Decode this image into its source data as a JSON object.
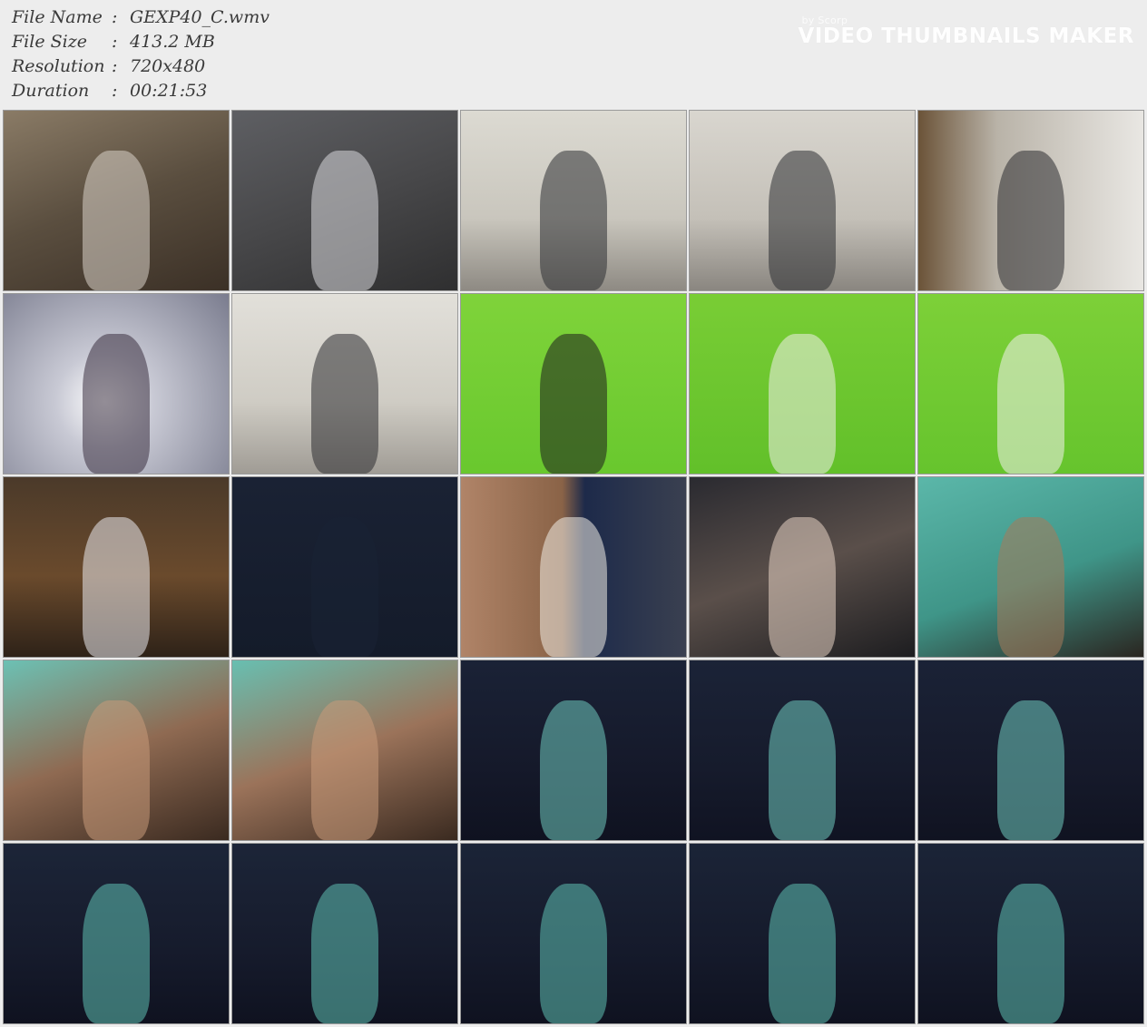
{
  "file_info": [
    {
      "label": "File Name",
      "sep": ":",
      "value": "GEXP40_C.wmv"
    },
    {
      "label": "File Size",
      "sep": ":",
      "value": "413.2 MB"
    },
    {
      "label": "Resolution",
      "sep": ":",
      "value": "720x480"
    },
    {
      "label": "Duration",
      "sep": ":",
      "value": "00:21:53"
    }
  ],
  "watermark": {
    "by_text": "by Scorp",
    "title": "VIDEO THUMBNAILS MAKER"
  },
  "thumbnails": [
    {
      "bg": "linear-gradient(160deg,#8a7b66 0%,#5a4e3f 50%,#3b3026 100%)",
      "accent": "#d8d2c8"
    },
    {
      "bg": "linear-gradient(160deg,#5e5f63 0%,#48484a 50%,#2f2f30 100%)",
      "accent": "#d9d9dc"
    },
    {
      "bg": "linear-gradient(180deg,#dcdad2 0%,#c9c6bd 60%,#8e8a83 100%)",
      "accent": "#2e2f33"
    },
    {
      "bg": "linear-gradient(180deg,#d9d6cf 0%,#c4c0b8 60%,#8a8680 100%)",
      "accent": "#2e2f33"
    },
    {
      "bg": "linear-gradient(90deg,#6b5338 0%,#b9b3a8 35%,#e9e7e3 100%)",
      "accent": "#2c2c30"
    },
    {
      "bg": "radial-gradient(circle at 45% 60%,#ffffff 0%,#c8c9d4 30%,#7a7c8e 100%)",
      "accent": "#3a3040"
    },
    {
      "bg": "linear-gradient(180deg,#e2e0da 0%,#cfccc4 60%,#a09c95 100%)",
      "accent": "#2d2e32"
    },
    {
      "bg": "linear-gradient(180deg,#7fd33a 0%,#69c82e 100%)",
      "accent": "#1e1e1e"
    },
    {
      "bg": "linear-gradient(180deg,#79cd35 0%,#62c02a 100%)",
      "accent": "#f1efe9"
    },
    {
      "bg": "linear-gradient(180deg,#7dd038 0%,#66c42d 100%)",
      "accent": "#f3f1ec"
    },
    {
      "bg": "linear-gradient(180deg,#4b3a2a 0%,#6a4a2c 55%,#2e2218 100%)",
      "accent": "#e9e9ef"
    },
    {
      "bg": "linear-gradient(180deg,#1a2234 0%,#141b2a 100%)",
      "accent": "#1a2234"
    },
    {
      "bg": "linear-gradient(90deg,#b08468 0%,#8a6347 45%,#1d2a4a 55%,#3a4050 100%)",
      "accent": "#f0ede6"
    },
    {
      "bg": "linear-gradient(160deg,#2a2a30 0%,#5a4f4a 50%,#1d1d20 100%)",
      "accent": "#e8d4c4"
    },
    {
      "bg": "linear-gradient(160deg,#5bb7a9 0%,#3f9588 55%,#2a2520 100%)",
      "accent": "#a87a5a"
    },
    {
      "bg": "linear-gradient(160deg,#6cc1b4 0%,#8f6a52 50%,#3a2a20 100%)",
      "accent": "#c99a7a"
    },
    {
      "bg": "linear-gradient(160deg,#68bfb1 0%,#9b735a 50%,#3a2a20 100%)",
      "accent": "#c99a7a"
    },
    {
      "bg": "linear-gradient(180deg,#1a2236 0%,#15192a 60%,#0f1220 100%)",
      "accent": "#6fc8bd"
    },
    {
      "bg": "linear-gradient(180deg,#1b2337 0%,#161b2c 60%,#101322 100%)",
      "accent": "#6fc8bd"
    },
    {
      "bg": "linear-gradient(180deg,#1a2236 0%,#161a2b 60%,#101321 100%)",
      "accent": "#6fc8bd"
    },
    {
      "bg": "linear-gradient(180deg,#1c2538 0%,#161b2c 60%,#0f1220 100%)",
      "accent": "#5fbfb2"
    },
    {
      "bg": "linear-gradient(180deg,#1c2538 0%,#161b2c 60%,#0f1220 100%)",
      "accent": "#5fbfb2"
    },
    {
      "bg": "linear-gradient(180deg,#1b2437 0%,#151a2b 60%,#0f1220 100%)",
      "accent": "#5fbfb2"
    },
    {
      "bg": "linear-gradient(180deg,#1b2437 0%,#151a2b 60%,#0f1220 100%)",
      "accent": "#5fbfb2"
    },
    {
      "bg": "linear-gradient(180deg,#1b2437 0%,#151a2b 60%,#0f1220 100%)",
      "accent": "#5fbfb2"
    }
  ]
}
